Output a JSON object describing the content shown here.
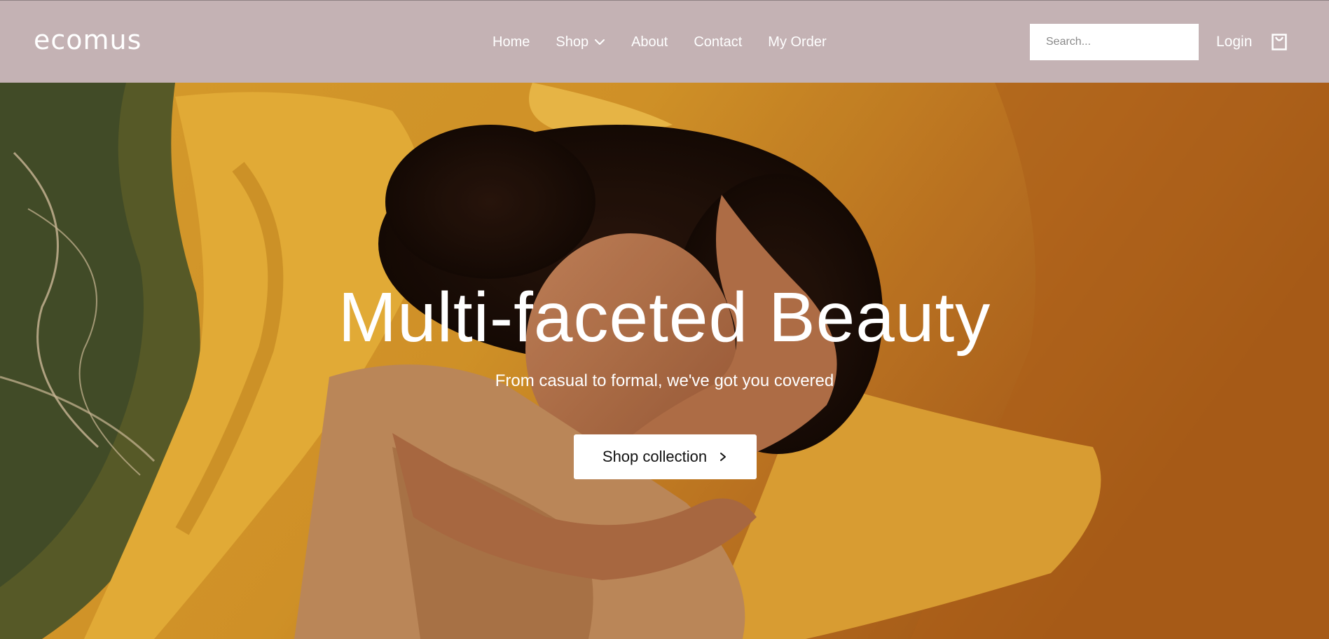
{
  "brand": {
    "logo_text": "ecomus"
  },
  "nav": {
    "items": [
      {
        "label": "Home"
      },
      {
        "label": "Shop"
      },
      {
        "label": "About"
      },
      {
        "label": "Contact"
      },
      {
        "label": "My Order"
      }
    ]
  },
  "header": {
    "search_placeholder": "Search...",
    "login_label": "Login",
    "cart_icon": "shopping-bag-icon",
    "background_color": "#c4b2b4"
  },
  "hero": {
    "title": "Multi-faceted Beauty",
    "subtitle": "From casual to formal, we've got you covered",
    "cta_label": "Shop collection",
    "cta_icon": "chevron-right-icon"
  }
}
